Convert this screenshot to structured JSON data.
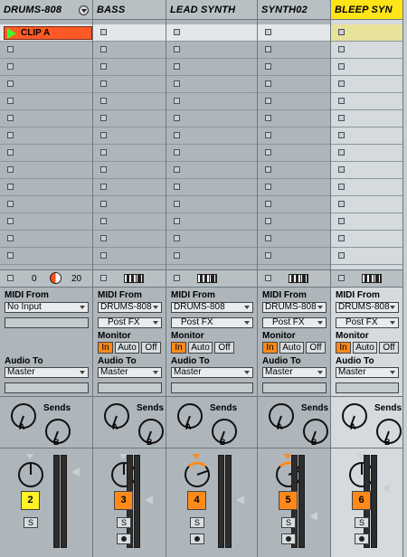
{
  "tracks": [
    {
      "name": "DRUMS-808",
      "has_dropdown": true,
      "midi_from": "No Input",
      "post_fx": "",
      "track_number": "2",
      "number_color": "#fff326",
      "monitor": null,
      "audio_to": "Master",
      "selected": false
    },
    {
      "name": "BASS",
      "midi_from": "DRUMS-808",
      "post_fx": "Post FX",
      "track_number": "3",
      "number_color": "#ff8a1a",
      "monitor_on": "In",
      "audio_to": "Master",
      "selected": false
    },
    {
      "name": "LEAD SYNTH",
      "midi_from": "DRUMS-808",
      "post_fx": "Post FX",
      "track_number": "4",
      "number_color": "#ff8a1a",
      "monitor_on": "In",
      "audio_to": "Master",
      "selected": false
    },
    {
      "name": "SYNTH02",
      "midi_from": "DRUMS-808",
      "post_fx": "Post FX",
      "track_number": "5",
      "number_color": "#ff8a1a",
      "monitor_on": "In",
      "audio_to": "Master",
      "selected": false
    },
    {
      "name": "BLEEP SYN",
      "midi_from": "DRUMS-808",
      "post_fx": "Post FX",
      "track_number": "6",
      "number_color": "#ff8a1a",
      "monitor_on": "In",
      "audio_to": "Master",
      "selected": true
    }
  ],
  "clip": {
    "name": "CLIP A",
    "color": "#ff5a26"
  },
  "drums_controls": {
    "value_left": "0",
    "value_right": "20"
  },
  "labels": {
    "midi_from": "MIDI From",
    "monitor": "Monitor",
    "audio_to": "Audio To",
    "sends": "Sends",
    "send_a": "A",
    "send_b": "B",
    "mon_in": "In",
    "mon_auto": "Auto",
    "mon_off": "Off",
    "solo": "S"
  },
  "colors": {
    "header_selected": "#ffe418",
    "accent": "#ff8a1a"
  }
}
